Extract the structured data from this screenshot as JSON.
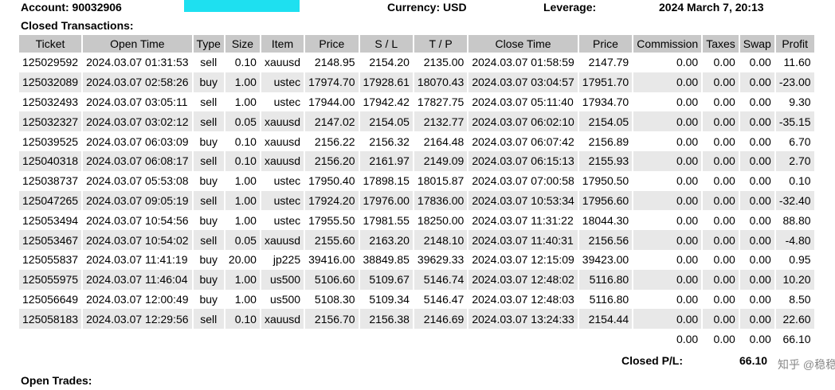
{
  "header": {
    "account_label": "Account: 90032906",
    "currency_label": "Currency: USD",
    "leverage_label": "Leverage:",
    "datetime": "2024 March 7, 20:13"
  },
  "closed_section_title": "Closed Transactions:",
  "columns": [
    "Ticket",
    "Open Time",
    "Type",
    "Size",
    "Item",
    "Price",
    "S / L",
    "T / P",
    "Close Time",
    "Price",
    "Commission",
    "Taxes",
    "Swap",
    "Profit"
  ],
  "rows": [
    [
      "125029592",
      "2024.03.07 01:31:53",
      "sell",
      "0.10",
      "xauusd",
      "2148.95",
      "2154.20",
      "2135.00",
      "2024.03.07 01:58:59",
      "2147.79",
      "0.00",
      "0.00",
      "0.00",
      "11.60"
    ],
    [
      "125032089",
      "2024.03.07 02:58:26",
      "buy",
      "1.00",
      "ustec",
      "17974.70",
      "17928.61",
      "18070.43",
      "2024.03.07 03:04:57",
      "17951.70",
      "0.00",
      "0.00",
      "0.00",
      "-23.00"
    ],
    [
      "125032493",
      "2024.03.07 03:05:11",
      "sell",
      "1.00",
      "ustec",
      "17944.00",
      "17942.42",
      "17827.75",
      "2024.03.07 05:11:40",
      "17934.70",
      "0.00",
      "0.00",
      "0.00",
      "9.30"
    ],
    [
      "125032327",
      "2024.03.07 03:02:12",
      "sell",
      "0.05",
      "xauusd",
      "2147.02",
      "2154.05",
      "2132.77",
      "2024.03.07 06:02:10",
      "2154.05",
      "0.00",
      "0.00",
      "0.00",
      "-35.15"
    ],
    [
      "125039525",
      "2024.03.07 06:03:09",
      "buy",
      "0.10",
      "xauusd",
      "2156.22",
      "2156.32",
      "2164.48",
      "2024.03.07 06:07:42",
      "2156.89",
      "0.00",
      "0.00",
      "0.00",
      "6.70"
    ],
    [
      "125040318",
      "2024.03.07 06:08:17",
      "sell",
      "0.10",
      "xauusd",
      "2156.20",
      "2161.97",
      "2149.09",
      "2024.03.07 06:15:13",
      "2155.93",
      "0.00",
      "0.00",
      "0.00",
      "2.70"
    ],
    [
      "125038737",
      "2024.03.07 05:53:08",
      "buy",
      "1.00",
      "ustec",
      "17950.40",
      "17898.15",
      "18015.87",
      "2024.03.07 07:00:58",
      "17950.50",
      "0.00",
      "0.00",
      "0.00",
      "0.10"
    ],
    [
      "125047265",
      "2024.03.07 09:05:19",
      "sell",
      "1.00",
      "ustec",
      "17924.20",
      "17976.00",
      "17836.00",
      "2024.03.07 10:53:34",
      "17956.60",
      "0.00",
      "0.00",
      "0.00",
      "-32.40"
    ],
    [
      "125053494",
      "2024.03.07 10:54:56",
      "buy",
      "1.00",
      "ustec",
      "17955.50",
      "17981.55",
      "18250.00",
      "2024.03.07 11:31:22",
      "18044.30",
      "0.00",
      "0.00",
      "0.00",
      "88.80"
    ],
    [
      "125053467",
      "2024.03.07 10:54:02",
      "sell",
      "0.05",
      "xauusd",
      "2155.60",
      "2163.20",
      "2148.10",
      "2024.03.07 11:40:31",
      "2156.56",
      "0.00",
      "0.00",
      "0.00",
      "-4.80"
    ],
    [
      "125055837",
      "2024.03.07 11:41:19",
      "buy",
      "20.00",
      "jp225",
      "39416.00",
      "38849.85",
      "39629.33",
      "2024.03.07 12:15:09",
      "39423.00",
      "0.00",
      "0.00",
      "0.00",
      "0.95"
    ],
    [
      "125055975",
      "2024.03.07 11:46:04",
      "buy",
      "1.00",
      "us500",
      "5106.60",
      "5109.67",
      "5146.74",
      "2024.03.07 12:48:02",
      "5116.80",
      "0.00",
      "0.00",
      "0.00",
      "10.20"
    ],
    [
      "125056649",
      "2024.03.07 12:00:49",
      "buy",
      "1.00",
      "us500",
      "5108.30",
      "5109.34",
      "5146.47",
      "2024.03.07 12:48:03",
      "5116.80",
      "0.00",
      "0.00",
      "0.00",
      "8.50"
    ],
    [
      "125058183",
      "2024.03.07 12:29:56",
      "sell",
      "0.10",
      "xauusd",
      "2156.70",
      "2156.38",
      "2146.69",
      "2024.03.07 13:24:33",
      "2154.44",
      "0.00",
      "0.00",
      "0.00",
      "22.60"
    ]
  ],
  "totals": {
    "commission": "0.00",
    "taxes": "0.00",
    "swap": "0.00",
    "profit": "66.10"
  },
  "closed_pl": {
    "label": "Closed P/L:",
    "value": "66.10"
  },
  "open_section_title": "Open Trades:",
  "watermark": "知乎 @稳稳牛"
}
